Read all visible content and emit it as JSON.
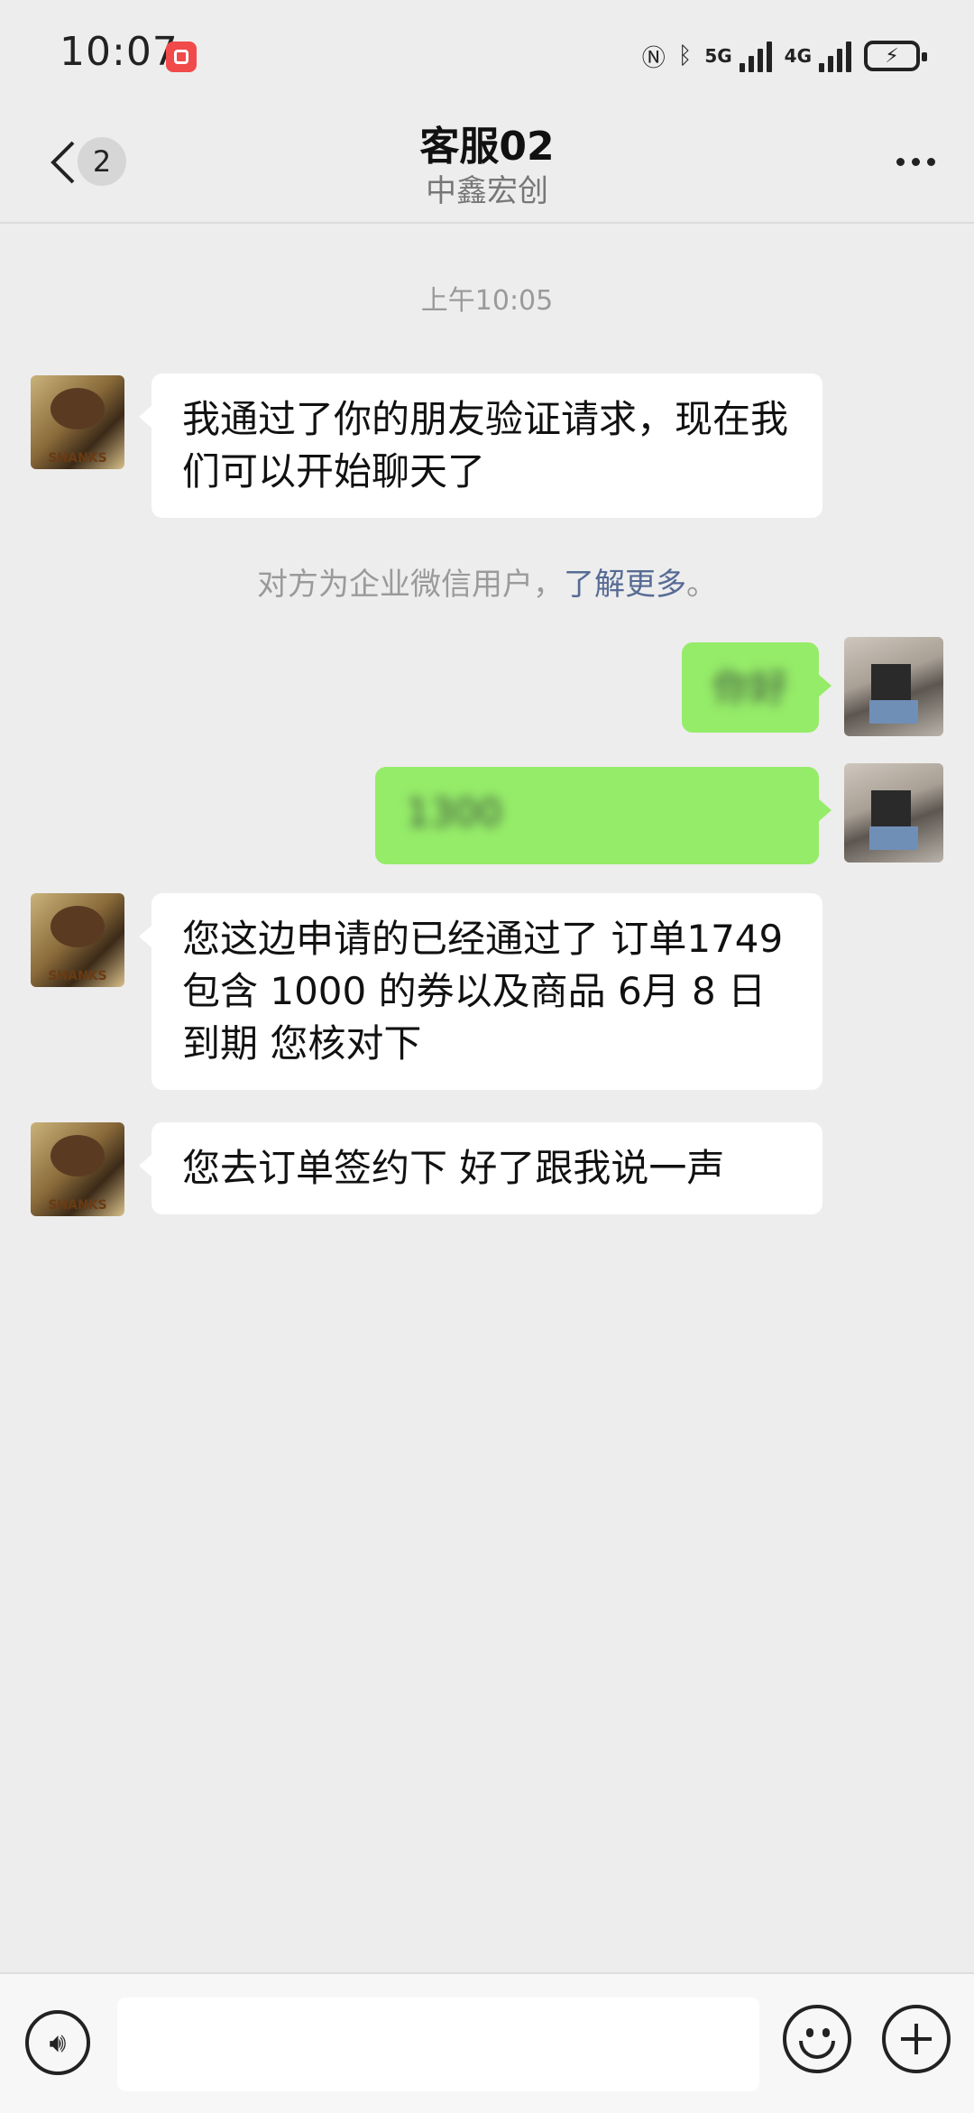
{
  "status_bar": {
    "time": "10:07",
    "net1": "5G",
    "net2": "4G",
    "battery_icon": "charging"
  },
  "header": {
    "back_badge": "2",
    "title": "客服02",
    "subtitle": "中鑫宏创"
  },
  "chat": {
    "timestamp": "上午10:05",
    "messages": [
      {
        "side": "left",
        "text": "我通过了你的朋友验证请求，现在我们可以开始聊天了"
      },
      {
        "side": "right",
        "text": "你好"
      },
      {
        "side": "right",
        "text": "1300"
      },
      {
        "side": "left",
        "text": "您这边申请的已经通过了  订单1749 包含 1000 的券以及商品   6月 8 日到期 您核对下"
      },
      {
        "side": "left",
        "text": "您去订单签约下   好了跟我说一声"
      }
    ],
    "system_notice": {
      "prefix": "对方为企业微信用户，",
      "link": "了解更多",
      "suffix": "。"
    }
  },
  "bottom_bar": {
    "voice_icon": "voice-icon",
    "emoji_icon": "emoji-icon",
    "plus_icon": "plus-icon"
  }
}
